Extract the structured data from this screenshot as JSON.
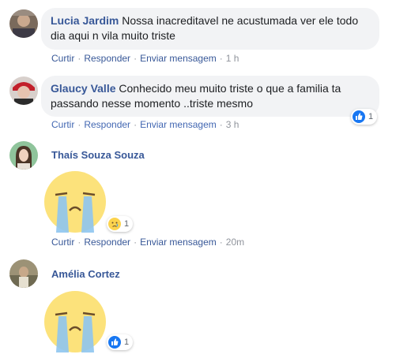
{
  "comments": [
    {
      "author": "Lucia Jardim",
      "text": "Nossa inacreditavel ne acustumada ver ele todo dia aqui n vila muito triste",
      "actions": {
        "cut": "Curtir",
        "reply": "Responder",
        "message": "Enviar mensagem",
        "time": "1 h"
      }
    },
    {
      "author": "Glaucy Valle",
      "text": "Conhecido meu muito triste o que a familia ta passando nesse momento ..triste mesmo",
      "actions": {
        "cut": "Curtir",
        "reply": "Responder",
        "message": "Enviar mensagem",
        "time": "3 h"
      },
      "reaction": {
        "icon": "like-icon",
        "count": "1"
      }
    },
    {
      "author": "Thaís Souza Souza",
      "sticker": "crying-face-sticker",
      "actions": {
        "cut": "Curtir",
        "reply": "Responder",
        "message": "Enviar mensagem",
        "time": "20m"
      },
      "reaction": {
        "icon": "sad-emoji-icon",
        "count": "1"
      }
    },
    {
      "author": "Amélia Cortez",
      "sticker": "crying-face-sticker",
      "reaction": {
        "icon": "like-icon",
        "count": "1"
      }
    }
  ],
  "separator": "·",
  "colors": {
    "link": "#385898",
    "bubble": "#f2f3f5",
    "meta": "#90949c",
    "like": "#1877f2"
  }
}
